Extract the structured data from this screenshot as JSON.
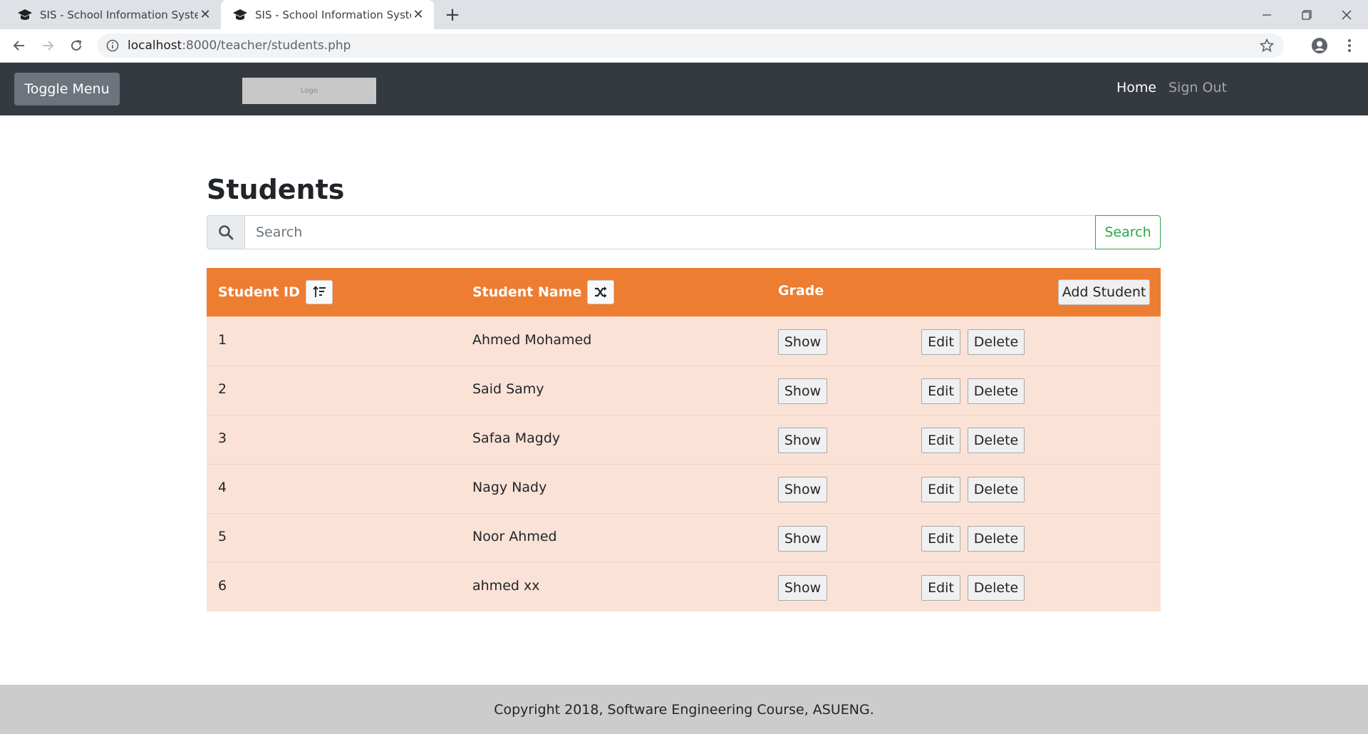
{
  "browser": {
    "tabs": [
      {
        "title": "SIS - School Information System",
        "active": false
      },
      {
        "title": "SIS - School Information System",
        "active": true
      }
    ],
    "url_host": "localhost",
    "url_rest": ":8000/teacher/students.php"
  },
  "navbar": {
    "toggle_label": "Toggle Menu",
    "logo_text": "Logo",
    "links": [
      "Home",
      "Sign Out"
    ],
    "bg_color": "#343a40"
  },
  "page": {
    "title": "Students",
    "search": {
      "placeholder": "Search",
      "button_label": "Search"
    }
  },
  "table": {
    "header_color": "#ed7d31",
    "row_color": "#fbe2d6",
    "columns": [
      "Student ID",
      "Student Name",
      "Grade"
    ],
    "add_label": "Add Student",
    "action_labels": {
      "show": "Show",
      "edit": "Edit",
      "delete": "Delete"
    },
    "rows": [
      {
        "id": "1",
        "name": "Ahmed Mohamed"
      },
      {
        "id": "2",
        "name": "Said Samy"
      },
      {
        "id": "3",
        "name": "Safaa Magdy"
      },
      {
        "id": "4",
        "name": "Nagy Nady"
      },
      {
        "id": "5",
        "name": "Noor Ahmed"
      },
      {
        "id": "6",
        "name": "ahmed xx"
      }
    ]
  },
  "footer": {
    "text": "Copyright 2018, Software Engineering Course, ASUENG."
  }
}
